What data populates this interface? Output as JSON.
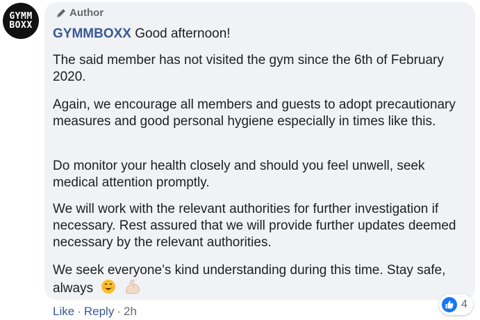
{
  "avatar": {
    "line1": "GYMM",
    "line2": "BOXX"
  },
  "badge": {
    "label": "Author"
  },
  "comment": {
    "author": "GYMMBOXX",
    "greeting": "Good afternoon!",
    "paragraphs": [
      "The said member has not visited the gym since the 6th of February 2020.",
      "Again, we encourage all members and guests to adopt precautionary measures and good personal hygiene especially in times like this.",
      "Do monitor your health closely and should you feel unwell, seek medical attention promptly.",
      "We will work with the relevant authorities for further investigation if necessary. Rest assured that we will provide further updates deemed necessary by the relevant authorities.",
      "We seek everyone’s kind understanding during this time. Stay safe, always"
    ]
  },
  "actions": {
    "like": "Like",
    "sep": "·",
    "reply": "Reply",
    "time": "2h"
  },
  "reactions": {
    "icon": "like-icon",
    "count": "4",
    "color": "#1877f2"
  },
  "icons": [
    "pencil-icon",
    "smiling-face-emoji",
    "flexed-biceps-emoji",
    "like-icon"
  ]
}
